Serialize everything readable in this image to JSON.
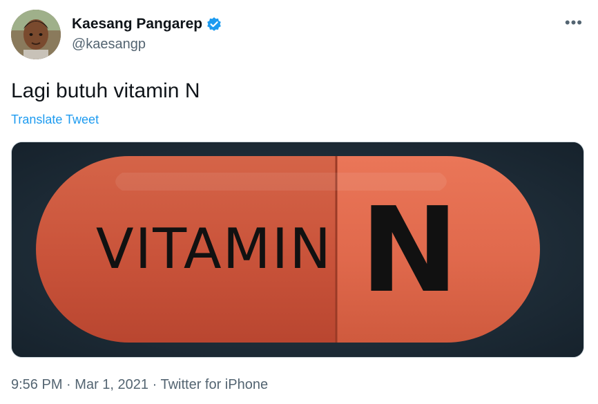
{
  "author": {
    "display_name": "Kaesang Pangarep",
    "handle": "@kaesangp",
    "verified": true
  },
  "tweet": {
    "text": "Lagi butuh vitamin N",
    "translate_label": "Translate Tweet",
    "media": {
      "left_text": "VITAMIN",
      "right_text": "N"
    }
  },
  "meta": {
    "time": "9:56 PM",
    "date": "Mar 1, 2021",
    "source": "Twitter for iPhone",
    "separator": "·"
  },
  "icons": {
    "more": "more-options-icon",
    "verified": "verified-badge-icon"
  },
  "colors": {
    "link": "#1d9bf0",
    "secondary_text": "#536471",
    "pill_dark": "#c9533a",
    "pill_light": "#e0694c",
    "media_bg": "#1d2a36"
  }
}
